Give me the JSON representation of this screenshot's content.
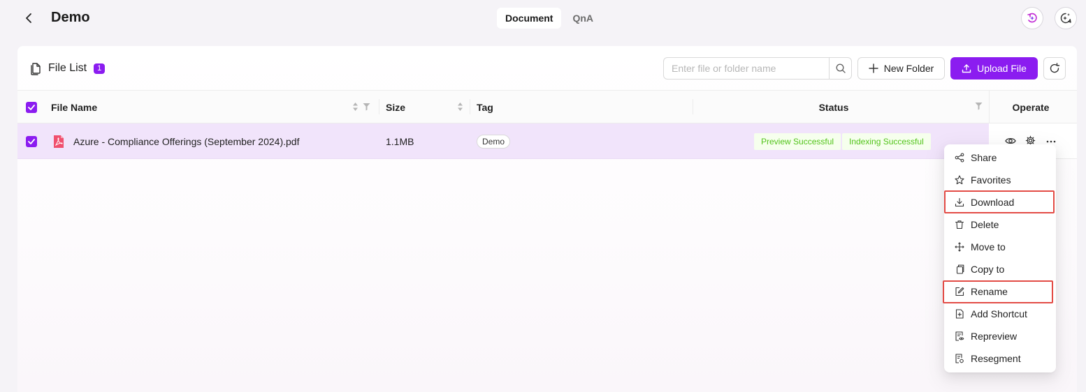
{
  "header": {
    "title": "Demo",
    "tabs": [
      {
        "label": "Document",
        "active": true
      },
      {
        "label": "QnA",
        "active": false
      }
    ]
  },
  "file_list": {
    "title": "File List",
    "count": "1",
    "search": {
      "placeholder": "Enter file or folder name",
      "value": ""
    },
    "new_folder_label": "New Folder",
    "upload_label": "Upload File"
  },
  "table": {
    "columns": {
      "name": "File Name",
      "size": "Size",
      "tag": "Tag",
      "status": "Status",
      "operate": "Operate"
    },
    "rows": [
      {
        "name": "Azure - Compliance Offerings (September 2024).pdf",
        "size": "1.1MB",
        "tag": "Demo",
        "statuses": [
          "Preview Successful",
          "Indexing Successful"
        ],
        "selected": true
      }
    ]
  },
  "context_menu": {
    "items": [
      {
        "label": "Share",
        "icon": "share-icon"
      },
      {
        "label": "Favorites",
        "icon": "star-icon"
      },
      {
        "label": "Download",
        "icon": "download-icon",
        "highlighted": true
      },
      {
        "label": "Delete",
        "icon": "trash-icon"
      },
      {
        "label": "Move to",
        "icon": "move-icon"
      },
      {
        "label": "Copy to",
        "icon": "copy-icon"
      },
      {
        "label": "Rename",
        "icon": "edit-icon",
        "highlighted": true
      },
      {
        "label": "Add Shortcut",
        "icon": "add-shortcut-icon"
      },
      {
        "label": "Repreview",
        "icon": "repreview-icon"
      },
      {
        "label": "Resegment",
        "icon": "resegment-icon"
      }
    ]
  },
  "colors": {
    "accent": "#8b1cf0",
    "row_selected": "#f1e4fb",
    "success": "#52c41a",
    "highlight_box": "#e34b45"
  }
}
